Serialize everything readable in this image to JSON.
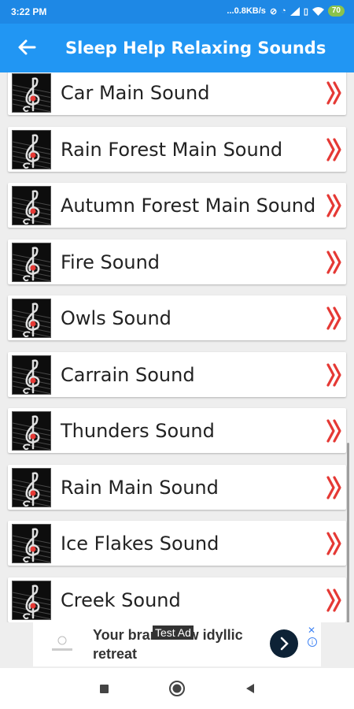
{
  "status_bar": {
    "time": "3:22 PM",
    "network_speed": "...0.8KB/s",
    "battery": "70",
    "icons": [
      "sync-off-icon",
      "alarm-icon",
      "signal-icon",
      "volte-icon",
      "wifi-icon",
      "battery-icon"
    ]
  },
  "app_bar": {
    "title": "Sleep Help Relaxing Sounds",
    "back_icon": "arrow-left-icon"
  },
  "sounds": [
    {
      "label": "Car Main Sound"
    },
    {
      "label": "Rain Forest Main Sound"
    },
    {
      "label": "Autumn Forest Main Sound"
    },
    {
      "label": "Fire Sound"
    },
    {
      "label": "Owls Sound"
    },
    {
      "label": "Carrain Sound"
    },
    {
      "label": "Thunders Sound"
    },
    {
      "label": "Rain Main Sound"
    },
    {
      "label": "Ice Flakes Sound"
    },
    {
      "label": "Creek Sound"
    }
  ],
  "ad": {
    "text": "Your brand new idyllic retreat",
    "badge": "Test Ad",
    "close_glyph": "✕",
    "info_glyph": "i"
  },
  "colors": {
    "app_bar": "#2196f3",
    "status_bar": "#1e88e5",
    "chevron": "#e53935"
  },
  "nav_bar": {
    "icons": [
      "recents-square-icon",
      "home-circle-icon",
      "back-triangle-icon"
    ]
  }
}
